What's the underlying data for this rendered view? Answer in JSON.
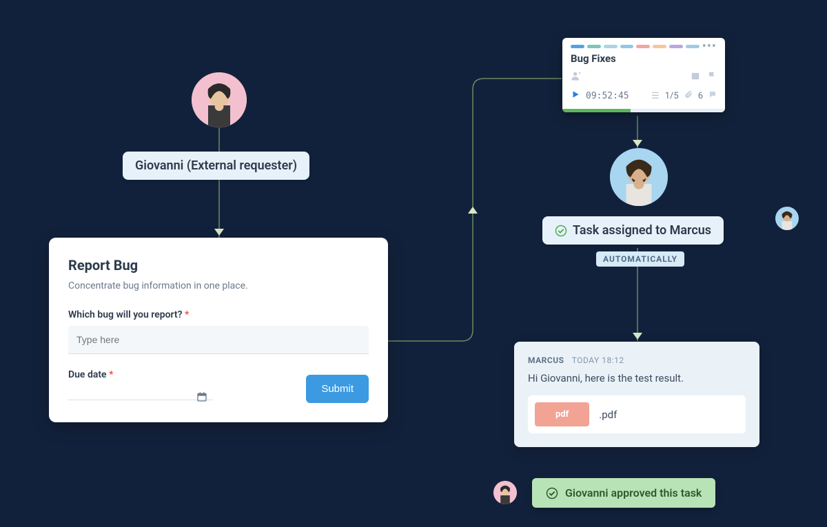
{
  "requester": {
    "label": "Giovanni (External requester)"
  },
  "form": {
    "title": "Report Bug",
    "subtitle": "Concentrate bug information in one place.",
    "field1_label": "Which bug will you report?",
    "field1_placeholder": "Type here",
    "field2_label": "Due date",
    "submit_label": "Submit"
  },
  "task_card": {
    "title": "Bug Fixes",
    "time": "09:52:45",
    "subtasks": "1/5",
    "attachments": "6",
    "strip_colors": [
      "#4fa3e3",
      "#7bc6b8",
      "#a8d4e8",
      "#8fc9e6",
      "#f3a5a0",
      "#f7c69a",
      "#b8a8e0",
      "#9fcbe8"
    ]
  },
  "assigned": {
    "label": "Task assigned to Marcus",
    "auto_tag": "AUTOMATICALLY"
  },
  "message": {
    "author": "MARCUS",
    "timestamp": "TODAY 18:12",
    "body": "Hi Giovanni, here is the test result.",
    "attachment_badge": "pdf",
    "attachment_ext": ".pdf"
  },
  "approval": {
    "label": "Giovanni approved this task"
  }
}
